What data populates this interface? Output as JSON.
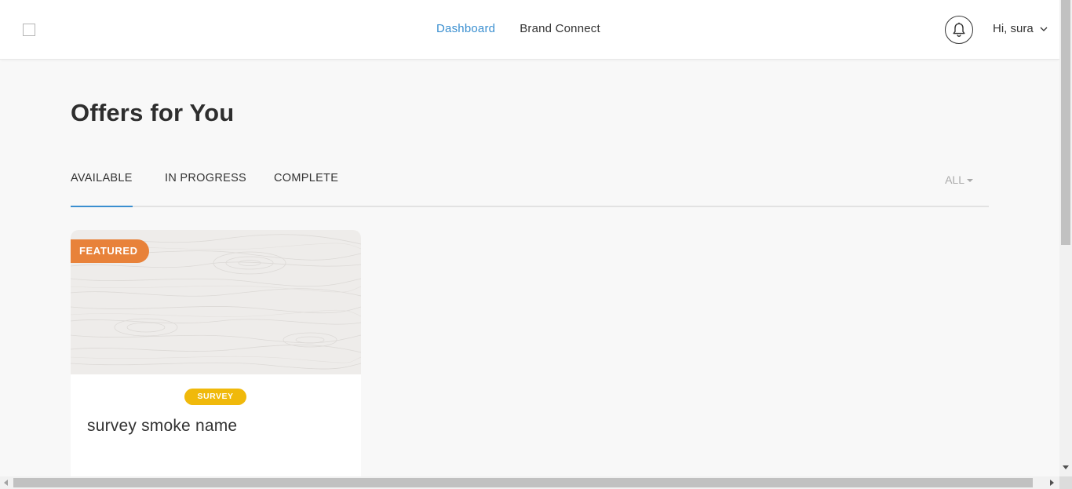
{
  "header": {
    "nav": [
      {
        "label": "Dashboard",
        "active": true
      },
      {
        "label": "Brand Connect",
        "active": false
      }
    ],
    "notifications_icon": "bell-icon",
    "user_greeting": "Hi, sura",
    "user_menu_icon": "chevron-down-icon"
  },
  "page": {
    "title": "Offers for You"
  },
  "tabs": {
    "items": [
      {
        "label": "AVAILABLE",
        "active": true
      },
      {
        "label": "IN PROGRESS",
        "active": false
      },
      {
        "label": "COMPLETE",
        "active": false
      }
    ],
    "filter": {
      "selected": "ALL",
      "icon": "caret-down-icon"
    }
  },
  "offers": [
    {
      "badge": "FEATURED",
      "type": "SURVEY",
      "title": "survey smoke name",
      "image": "wood-texture"
    }
  ],
  "colors": {
    "accent": "#3a8fd0",
    "featured": "#e8823a",
    "survey_tag": "#f0b90b",
    "text": "#333333",
    "page_bg": "#f8f8f8"
  }
}
